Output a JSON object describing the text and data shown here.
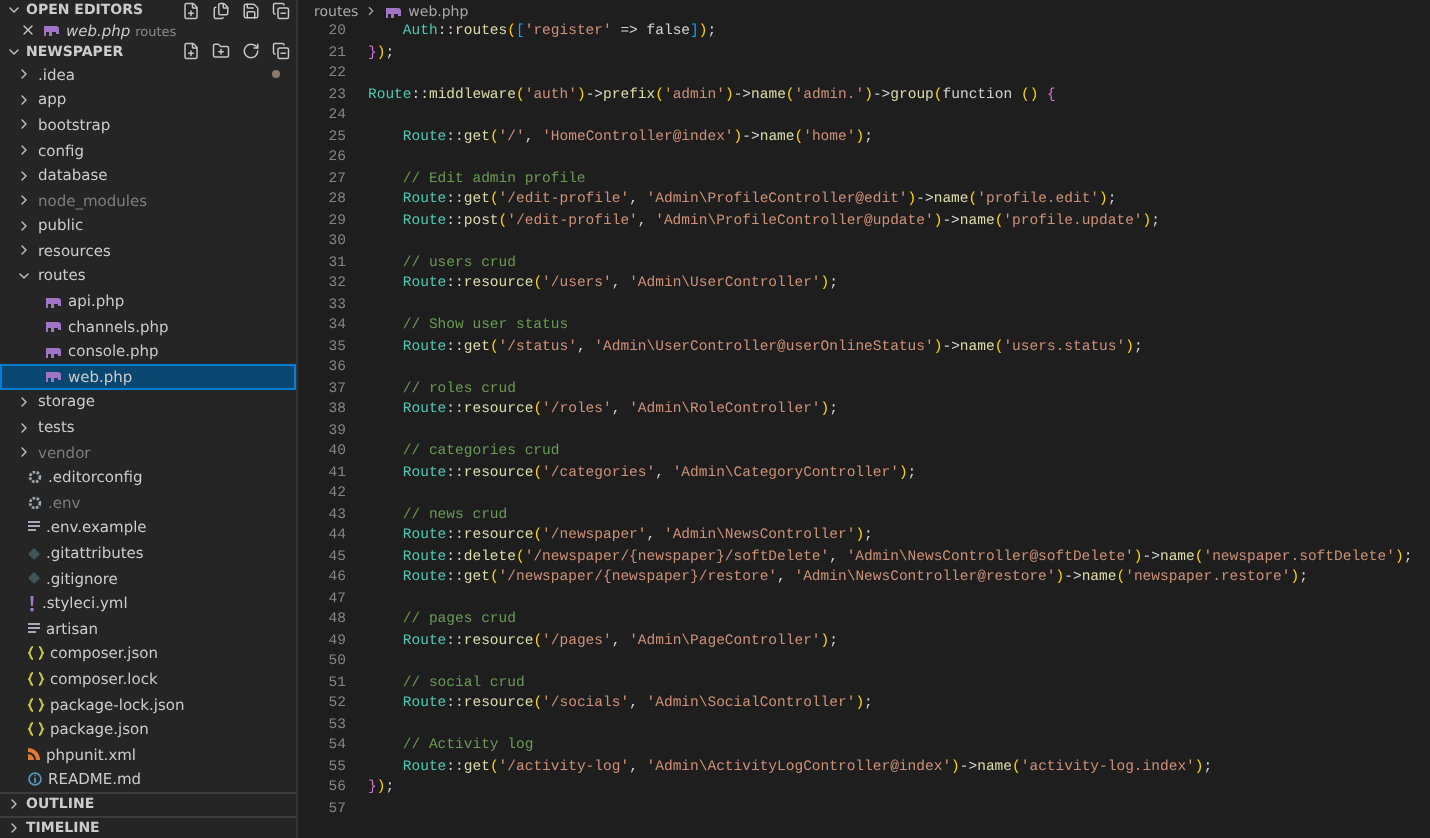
{
  "open_editors": {
    "title": "OPEN EDITORS",
    "expanded": true,
    "items": [
      {
        "name": "web.php",
        "folder": "routes",
        "kind": "php",
        "selected": false
      }
    ]
  },
  "explorer": {
    "title": "NEWSPAPER",
    "expanded": true,
    "items": [
      {
        "name": ".idea",
        "kind": "folder",
        "expanded": false,
        "dimmed": false,
        "modified": true,
        "selected": false
      },
      {
        "name": "app",
        "kind": "folder",
        "expanded": false,
        "dimmed": false,
        "modified": false,
        "selected": false
      },
      {
        "name": "bootstrap",
        "kind": "folder",
        "expanded": false,
        "dimmed": false,
        "modified": false,
        "selected": false
      },
      {
        "name": "config",
        "kind": "folder",
        "expanded": false,
        "dimmed": false,
        "modified": false,
        "selected": false
      },
      {
        "name": "database",
        "kind": "folder",
        "expanded": false,
        "dimmed": false,
        "modified": false,
        "selected": false
      },
      {
        "name": "node_modules",
        "kind": "folder",
        "expanded": false,
        "dimmed": true,
        "modified": false,
        "selected": false
      },
      {
        "name": "public",
        "kind": "folder",
        "expanded": false,
        "dimmed": false,
        "modified": false,
        "selected": false
      },
      {
        "name": "resources",
        "kind": "folder",
        "expanded": false,
        "dimmed": false,
        "modified": false,
        "selected": false
      },
      {
        "name": "routes",
        "kind": "folder",
        "expanded": true,
        "dimmed": false,
        "modified": false,
        "selected": false,
        "children": [
          {
            "name": "api.php",
            "kind": "php",
            "dimmed": false,
            "modified": false,
            "selected": false
          },
          {
            "name": "channels.php",
            "kind": "php",
            "dimmed": false,
            "modified": false,
            "selected": false
          },
          {
            "name": "console.php",
            "kind": "php",
            "dimmed": false,
            "modified": false,
            "selected": false
          },
          {
            "name": "web.php",
            "kind": "php",
            "dimmed": false,
            "modified": false,
            "selected": true
          }
        ]
      },
      {
        "name": "storage",
        "kind": "folder",
        "expanded": false,
        "dimmed": false,
        "modified": false,
        "selected": false
      },
      {
        "name": "tests",
        "kind": "folder",
        "expanded": false,
        "dimmed": false,
        "modified": false,
        "selected": false
      },
      {
        "name": "vendor",
        "kind": "folder",
        "expanded": false,
        "dimmed": true,
        "modified": false,
        "selected": false
      },
      {
        "name": ".editorconfig",
        "kind": "config",
        "dimmed": false,
        "modified": false,
        "selected": false
      },
      {
        "name": ".env",
        "kind": "config",
        "dimmed": true,
        "modified": false,
        "selected": false
      },
      {
        "name": ".env.example",
        "kind": "text",
        "dimmed": false,
        "modified": false,
        "selected": false
      },
      {
        "name": ".gitattributes",
        "kind": "git",
        "dimmed": false,
        "modified": false,
        "selected": false
      },
      {
        "name": ".gitignore",
        "kind": "git",
        "dimmed": false,
        "modified": false,
        "selected": false
      },
      {
        "name": ".styleci.yml",
        "kind": "yaml",
        "dimmed": false,
        "modified": false,
        "selected": false
      },
      {
        "name": "artisan",
        "kind": "text",
        "dimmed": false,
        "modified": false,
        "selected": false
      },
      {
        "name": "composer.json",
        "kind": "json",
        "dimmed": false,
        "modified": false,
        "selected": false
      },
      {
        "name": "composer.lock",
        "kind": "json",
        "dimmed": false,
        "modified": false,
        "selected": false
      },
      {
        "name": "package-lock.json",
        "kind": "json",
        "dimmed": false,
        "modified": false,
        "selected": false
      },
      {
        "name": "package.json",
        "kind": "json",
        "dimmed": false,
        "modified": false,
        "selected": false
      },
      {
        "name": "phpunit.xml",
        "kind": "xml",
        "dimmed": false,
        "modified": false,
        "selected": false
      },
      {
        "name": "README.md",
        "kind": "info",
        "dimmed": false,
        "modified": false,
        "selected": false
      }
    ]
  },
  "bottom_sections": [
    {
      "title": "OUTLINE",
      "expanded": false
    },
    {
      "title": "TIMELINE",
      "expanded": false
    }
  ],
  "breadcrumb": [
    {
      "label": "routes",
      "kind": "folder"
    },
    {
      "label": "web.php",
      "kind": "php"
    }
  ],
  "code_lines": [
    {
      "number": "20",
      "code": "    Auth::routes(['register' => false]);"
    },
    {
      "number": "21",
      "code": "});"
    },
    {
      "number": "22"
    },
    {
      "number": "23",
      "code": "Route::middleware('auth')->prefix('admin')->name('admin.')->group(function () {"
    },
    {
      "number": "24"
    },
    {
      "number": "25",
      "code": "    Route::get('/', 'HomeController@index')->name('home');"
    },
    {
      "number": "26"
    },
    {
      "number": "27",
      "code": "    // Edit admin profile"
    },
    {
      "number": "28",
      "code": "    Route::get('/edit-profile', 'Admin\\ProfileController@edit')->name('profile.edit');"
    },
    {
      "number": "29",
      "code": "    Route::post('/edit-profile', 'Admin\\ProfileController@update')->name('profile.update');"
    },
    {
      "number": "30"
    },
    {
      "number": "31",
      "code": "    // users crud"
    },
    {
      "number": "32",
      "code": "    Route::resource('/users', 'Admin\\UserController');"
    },
    {
      "number": "33"
    },
    {
      "number": "34",
      "code": "    // Show user status"
    },
    {
      "number": "35",
      "code": "    Route::get('/status', 'Admin\\UserController@userOnlineStatus')->name('users.status');"
    },
    {
      "number": "36"
    },
    {
      "number": "37",
      "code": "    // roles crud"
    },
    {
      "number": "38",
      "code": "    Route::resource('/roles', 'Admin\\RoleController');"
    },
    {
      "number": "39"
    },
    {
      "number": "40",
      "code": "    // categories crud"
    },
    {
      "number": "41",
      "code": "    Route::resource('/categories', 'Admin\\CategoryController');"
    },
    {
      "number": "42"
    },
    {
      "number": "43",
      "code": "    // news crud"
    },
    {
      "number": "44",
      "code": "    Route::resource('/newspaper', 'Admin\\NewsController');"
    },
    {
      "number": "45",
      "code": "    Route::delete('/newspaper/{newspaper}/softDelete', 'Admin\\NewsController@softDelete')->name('newspaper.softDelete');"
    },
    {
      "number": "46",
      "code": "    Route::get('/newspaper/{newspaper}/restore', 'Admin\\NewsController@restore')->name('newspaper.restore');"
    },
    {
      "number": "47"
    },
    {
      "number": "48",
      "code": "    // pages crud"
    },
    {
      "number": "49",
      "code": "    Route::resource('/pages', 'Admin\\PageController');"
    },
    {
      "number": "50"
    },
    {
      "number": "51",
      "code": "    // social crud"
    },
    {
      "number": "52",
      "code": "    Route::resource('/socials', 'Admin\\SocialController');"
    },
    {
      "number": "53"
    },
    {
      "number": "54",
      "code": "    // Activity log"
    },
    {
      "number": "55",
      "code": "    Route::get('/activity-log', 'Admin\\ActivityLogController@index')->name('activity-log.index');"
    },
    {
      "number": "56",
      "code": "});"
    },
    {
      "number": "57"
    }
  ]
}
